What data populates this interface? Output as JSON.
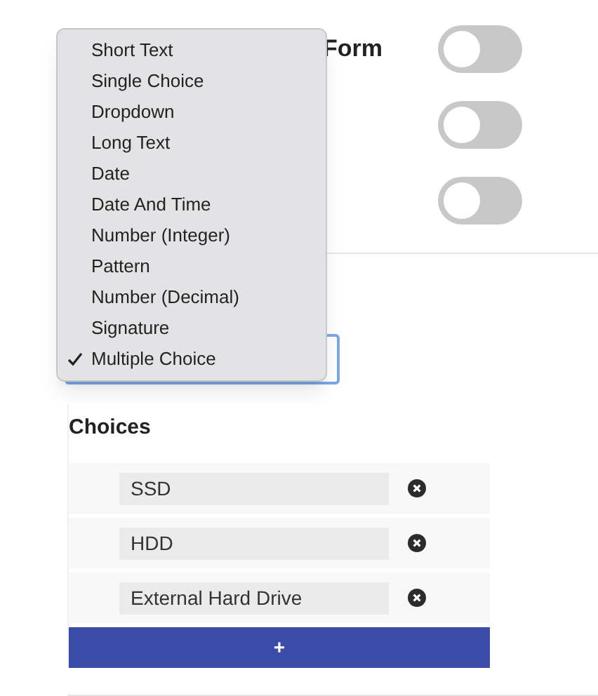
{
  "settings": [
    {
      "label": "Form",
      "on": false
    },
    {
      "on": false
    },
    {
      "on": false
    }
  ],
  "type_menu": {
    "options": [
      {
        "label": "Short Text",
        "selected": false
      },
      {
        "label": "Single Choice",
        "selected": false
      },
      {
        "label": "Dropdown",
        "selected": false
      },
      {
        "label": "Long Text",
        "selected": false
      },
      {
        "label": "Date",
        "selected": false
      },
      {
        "label": "Date And Time",
        "selected": false
      },
      {
        "label": "Number (Integer)",
        "selected": false
      },
      {
        "label": "Pattern",
        "selected": false
      },
      {
        "label": "Number (Decimal)",
        "selected": false
      },
      {
        "label": "Signature",
        "selected": false
      },
      {
        "label": "Multiple Choice",
        "selected": true
      }
    ]
  },
  "choices": {
    "title": "Choices",
    "items": [
      {
        "value": "SSD"
      },
      {
        "value": "HDD"
      },
      {
        "value": "External Hard Drive"
      }
    ],
    "add_button": "+"
  }
}
